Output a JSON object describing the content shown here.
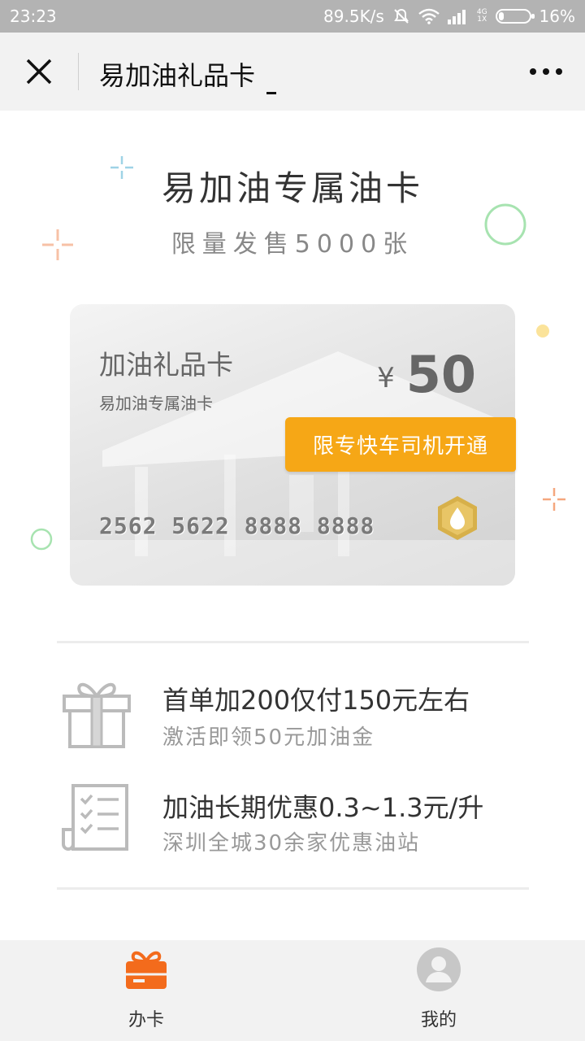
{
  "status_bar": {
    "time": "23:23",
    "speed": "89.5K/s",
    "net_top": "4G",
    "net_bottom": "1X",
    "battery": "16%",
    "battery_level": 0.16
  },
  "header": {
    "title": "易加油礼品卡"
  },
  "hero": {
    "title": "易加油专属油卡",
    "subtitle": "限量发售5000张"
  },
  "card": {
    "title": "加油礼品卡",
    "subtitle": "易加油专属油卡",
    "currency": "¥",
    "amount": "50",
    "number": "2562 5622 8888 8888",
    "badge": "限专快车司机开通"
  },
  "features": [
    {
      "icon": "gift-icon",
      "main": "首单加200仅付150元左右",
      "desc": "激活即领50元加油金"
    },
    {
      "icon": "checklist-icon",
      "main": "加油长期优惠0.3~1.3元/升",
      "desc": "深圳全城30余家优惠油站"
    }
  ],
  "bottom_nav": [
    {
      "label": "办卡",
      "icon": "card-gift-icon",
      "active": true
    },
    {
      "label": "我的",
      "icon": "user-icon",
      "active": false
    }
  ],
  "colors": {
    "accent_orange": "#f6a716",
    "nav_active": "#f36b1c",
    "deco_green": "#a7e3b0",
    "deco_blue": "#9fd3e6",
    "deco_peach": "#f7c1a6",
    "deco_yellow": "#fbe39a"
  }
}
